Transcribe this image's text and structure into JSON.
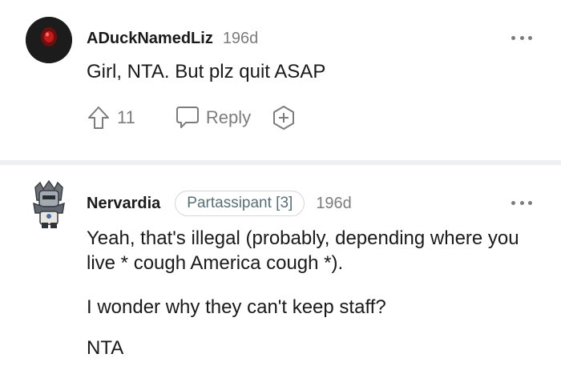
{
  "comments": [
    {
      "author": "ADuckNamedLiz",
      "time": "196d",
      "body": [
        "Girl, NTA. But plz quit ASAP"
      ],
      "upvotes": "11",
      "reply_label": "Reply",
      "avatar_icon": "dark-circle-red-dot-avatar"
    },
    {
      "author": "Nervardia",
      "flair": "Partassipant [3]",
      "time": "196d",
      "body": [
        "Yeah, that's illegal (probably, depending where you live * cough America cough *).",
        "I wonder why they can't keep staff?",
        "NTA"
      ],
      "avatar_icon": "armored-character-avatar"
    }
  ],
  "colors": {
    "text": "#1a1a1b",
    "meta": "#7c7c7c",
    "divider": "#edeff1",
    "flair_text": "#576f76"
  }
}
